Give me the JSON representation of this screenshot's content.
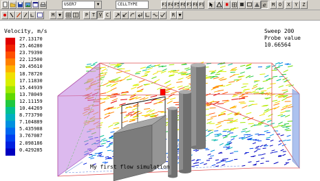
{
  "toolbar1": {
    "object_combo": "USER7",
    "type_combo": "CELLTYPE",
    "function_keys": [
      "F3",
      "F4",
      "F5",
      "F6",
      "F7",
      "F8",
      "F9"
    ],
    "axis_buttons": [
      "M",
      "O",
      "X",
      "Y",
      "Z"
    ]
  },
  "toolbar2": {
    "view_letters": [
      "M",
      "P",
      "T",
      "V",
      "C"
    ],
    "r_combo": "R"
  },
  "legend": {
    "title": "Velocity, m/s",
    "values": [
      "27.13170",
      "25.46280",
      "23.79390",
      "22.12500",
      "20.45610",
      "18.78720",
      "17.11830",
      "15.44939",
      "13.78049",
      "12.11159",
      "10.44269",
      "8.773790",
      "7.104889",
      "5.435988",
      "3.767087",
      "2.098186",
      "0.429285"
    ],
    "colors": [
      "#e00000",
      "#f02000",
      "#ff5000",
      "#ff8000",
      "#ffb000",
      "#f0e000",
      "#d8f000",
      "#a0e800",
      "#60d800",
      "#20c840",
      "#00c090",
      "#00b0c0",
      "#0090e0",
      "#0068f0",
      "#0040f0",
      "#0020e0",
      "#0000c0"
    ]
  },
  "sweep": "Sweep 200",
  "probe_label": "Probe value",
  "probe_value": "10.66564",
  "caption": "My first flow simulation"
}
